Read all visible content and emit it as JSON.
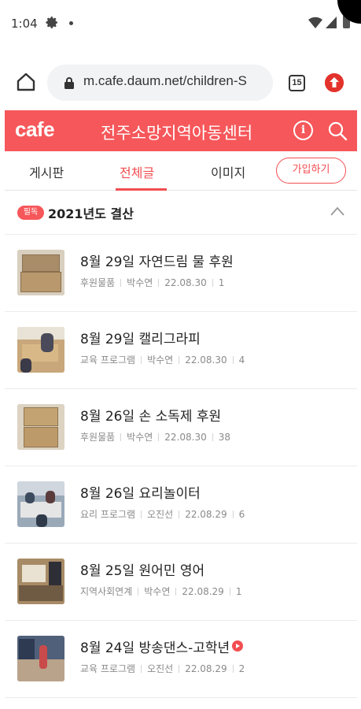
{
  "status_bar": {
    "time": "1:04"
  },
  "browser": {
    "url": "m.cafe.daum.net/children-S",
    "tab_count": "15"
  },
  "cafe": {
    "logo": "cafe",
    "name": "전주소망지역아동센터"
  },
  "nav": {
    "tabs": [
      "게시판",
      "전체글",
      "이미지"
    ],
    "active_tab": "전체글",
    "join_label": "가입하기"
  },
  "notice": {
    "badge": "필독",
    "title": "2021년도 결산"
  },
  "posts": [
    {
      "title": "8월 29일 자연드림 물 후원",
      "category": "후원물품",
      "author": "박수연",
      "date": "22.08.30",
      "count": "1"
    },
    {
      "title": "8월 29일 캘리그라피",
      "category": "교육 프로그램",
      "author": "박수연",
      "date": "22.08.30",
      "count": "4"
    },
    {
      "title": "8월 26일 손 소독제 후원",
      "category": "후원물품",
      "author": "박수연",
      "date": "22.08.30",
      "count": "38"
    },
    {
      "title": "8월 26일 요리놀이터",
      "category": "요리 프로그램",
      "author": "오진선",
      "date": "22.08.29",
      "count": "6"
    },
    {
      "title": "8월 25일 원어민 영어",
      "category": "지역사회연계",
      "author": "박수연",
      "date": "22.08.29",
      "count": "1"
    },
    {
      "title": "8월 24일 방송댄스-고학년",
      "category": "교육 프로그램",
      "author": "오진선",
      "date": "22.08.29",
      "count": "2",
      "has_video": true
    }
  ],
  "colors": {
    "brand": "#f6575a",
    "accent": "#f24d50"
  }
}
